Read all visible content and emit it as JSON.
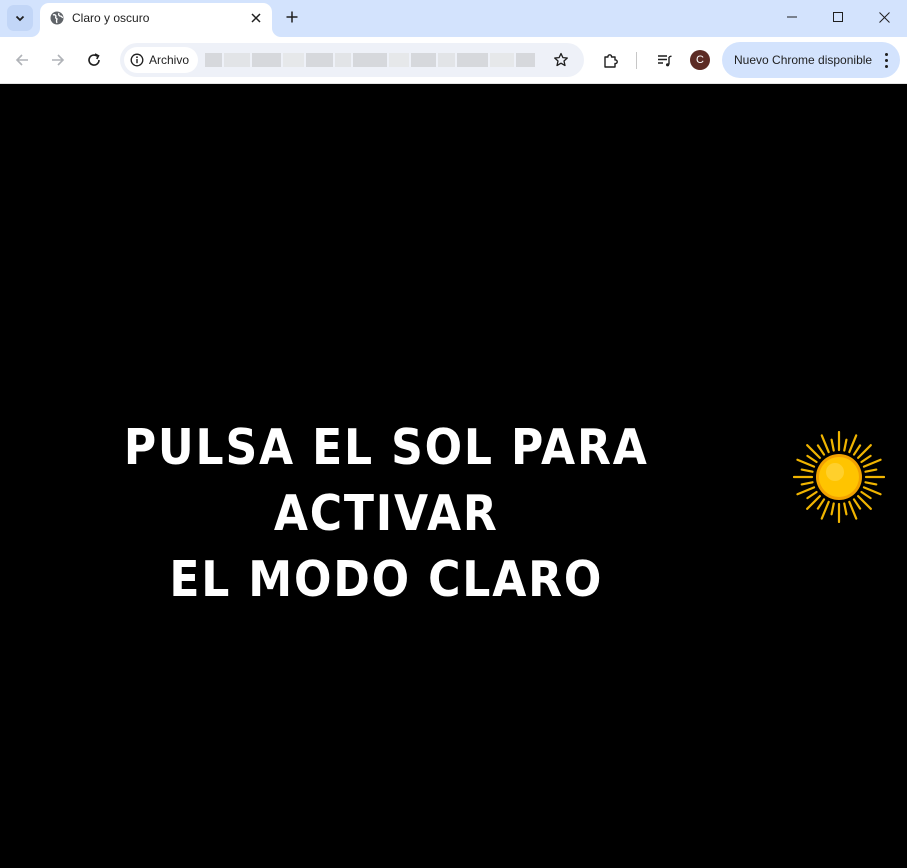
{
  "browser": {
    "tab": {
      "title": "Claro y oscuro"
    },
    "address": {
      "security_chip_label": "Archivo"
    },
    "profile_initial": "C",
    "update_button_label": "Nuevo Chrome disponible"
  },
  "page": {
    "background_color": "#000000",
    "headline_line1": "PULSA EL SOL PARA ACTIVAR",
    "headline_line2": "EL MODO CLARO",
    "sun_icon": "sun-icon"
  }
}
